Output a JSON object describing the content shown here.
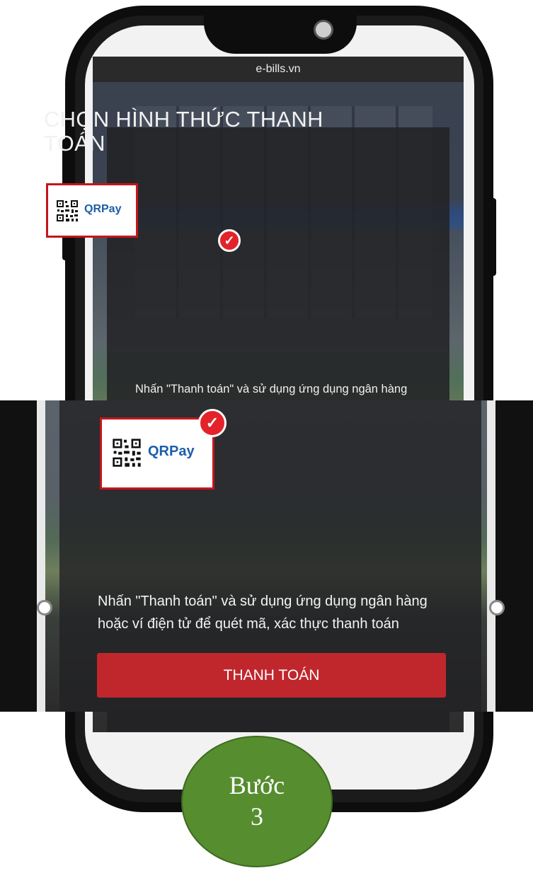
{
  "browser": {
    "url": "e-bills.vn"
  },
  "payment": {
    "title": "CHỌN HÌNH THỨC THANH TOÁN",
    "method_label": "QRPay",
    "description_line1": "Nhấn \"Thanh toán\" và sử dụng ứng dụng ngân hàng",
    "description_line2": "hoặc ví điện tử để quét mã, xác thực thanh toán",
    "pay_button_label": "THANH TOÁN"
  },
  "step": {
    "word": "Bước",
    "number": "3"
  },
  "colors": {
    "accent": "#c0272d",
    "qr_text": "#1d5ea8",
    "step_badge": "#568d2f"
  },
  "icons": {
    "selected": "check-circle-icon",
    "qr": "qr-code-icon"
  }
}
